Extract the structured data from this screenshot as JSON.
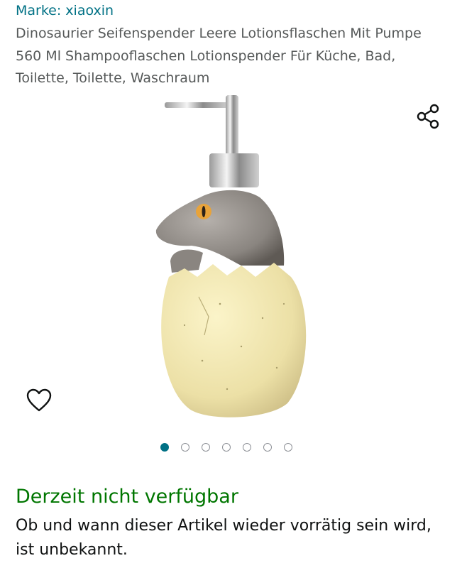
{
  "brand": {
    "label": "Marke: xiaoxin"
  },
  "product": {
    "title": "Dinosaurier Seifenspender Leere Lotionsflaschen Mit Pumpe 560 Ml Shampooflaschen Lotionspender Für Küche, Bad, Toilette, Toilette, Waschraum"
  },
  "gallery": {
    "dot_count": 7,
    "active_index": 0
  },
  "icons": {
    "share": "share-icon",
    "wishlist": "heart-outline-icon"
  },
  "availability": {
    "status": "Derzeit nicht verfügbar",
    "message": "Ob und wann dieser Artikel wieder vorrätig sein wird, ist unbekannt."
  },
  "colors": {
    "link": "#007185",
    "availability": "#007600",
    "title": "#565959"
  }
}
